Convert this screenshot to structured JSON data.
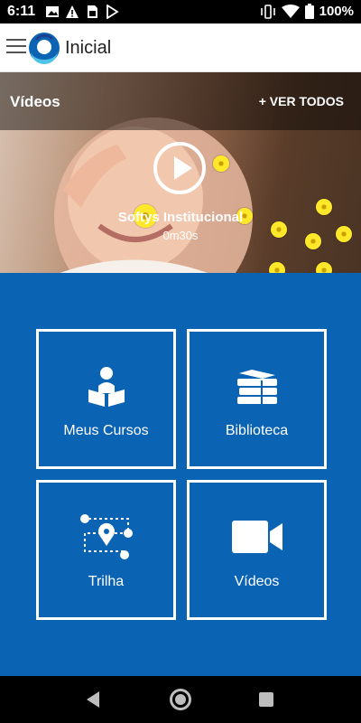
{
  "status_bar": {
    "time": "6:11",
    "battery": "100%",
    "left_icons": [
      "image-icon",
      "warning-icon",
      "sim-icon",
      "play-store-icon"
    ],
    "right_icons": [
      "vibrate-icon",
      "wifi-icon",
      "battery-icon"
    ]
  },
  "app_bar": {
    "title": "Inicial",
    "menu_icon": "hamburger-menu-icon",
    "logo_icon": "app-logo-icon"
  },
  "hero": {
    "section_title": "Vídeos",
    "see_all_label": "+ VER TODOS",
    "video_title": "Softys Institucional",
    "video_duration": "0m30s",
    "play_icon": "play-icon"
  },
  "tiles": [
    {
      "label": "Meus Cursos",
      "icon": "reading-person-icon"
    },
    {
      "label": "Biblioteca",
      "icon": "books-icon"
    },
    {
      "label": "Trilha",
      "icon": "route-map-icon"
    },
    {
      "label": "Vídeos",
      "icon": "video-camera-icon"
    }
  ],
  "colors": {
    "primary_blue": "#0b63b4",
    "flower_yellow": "#ffe82a",
    "tile_border": "#ffffff"
  },
  "nav_bar": {
    "icons": [
      "back-icon",
      "home-icon",
      "recents-icon"
    ]
  }
}
